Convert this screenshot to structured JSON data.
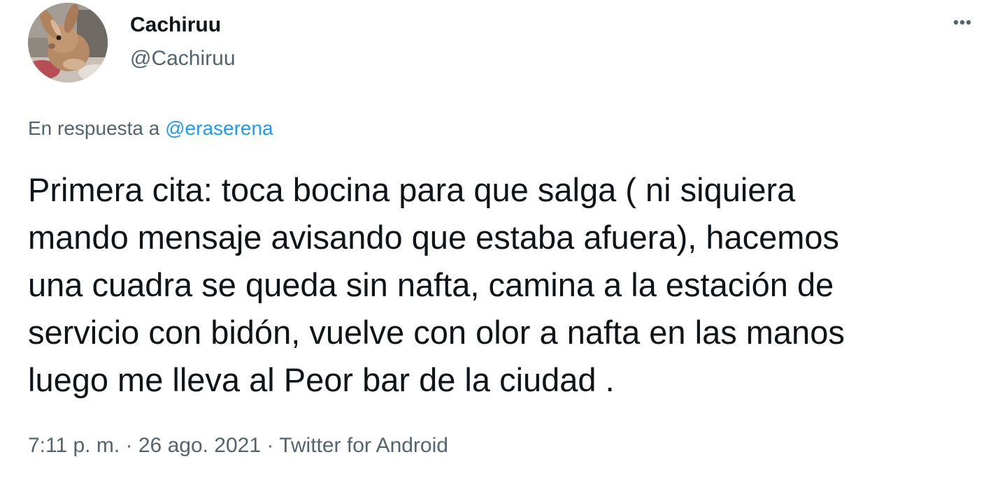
{
  "user": {
    "display_name": "Cachiruu",
    "handle": "@Cachiruu",
    "avatar_icon": "rabbit-avatar-photo"
  },
  "reply": {
    "prefix": "En respuesta a",
    "mention": "@eraserena"
  },
  "tweet": {
    "lines": [
      "Primera cita: toca bocina para que salga ( ni siquiera",
      "mando mensaje avisando que estaba afuera), hacemos",
      "una cuadra se queda sin nafta, camina a la estación de",
      "servicio con bidón, vuelve con olor a nafta en las manos",
      "luego me lleva al Peor bar de la ciudad ."
    ]
  },
  "meta": {
    "time": "7:11 p. m.",
    "separator": "·",
    "date": "26 ago. 2021",
    "source": "Twitter for Android"
  },
  "icons": {
    "more": "more-horizontal-icon"
  },
  "colors": {
    "text": "#0f1419",
    "secondary": "#536471",
    "link": "#1d9bf0",
    "background": "#ffffff"
  }
}
